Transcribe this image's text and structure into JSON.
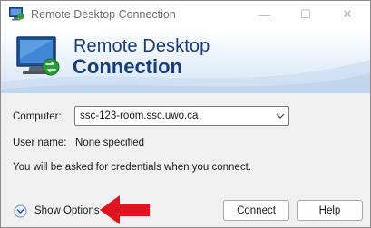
{
  "window": {
    "title": "Remote Desktop Connection",
    "controls": {
      "minimize": "—",
      "maximize": "☐",
      "close": "✕"
    }
  },
  "banner": {
    "line1": "Remote Desktop",
    "line2": "Connection"
  },
  "form": {
    "computer_label": "Computer:",
    "computer_value": "ssc-123-room.ssc.uwo.ca",
    "username_label": "User name:",
    "username_value": "None specified",
    "credentials_notice": "You will be asked for credentials when you connect."
  },
  "footer": {
    "show_options_label": "Show Options",
    "connect_label": "Connect",
    "help_label": "Help"
  },
  "colors": {
    "banner_text": "#163c7a",
    "annotation_arrow": "#e0141e"
  }
}
